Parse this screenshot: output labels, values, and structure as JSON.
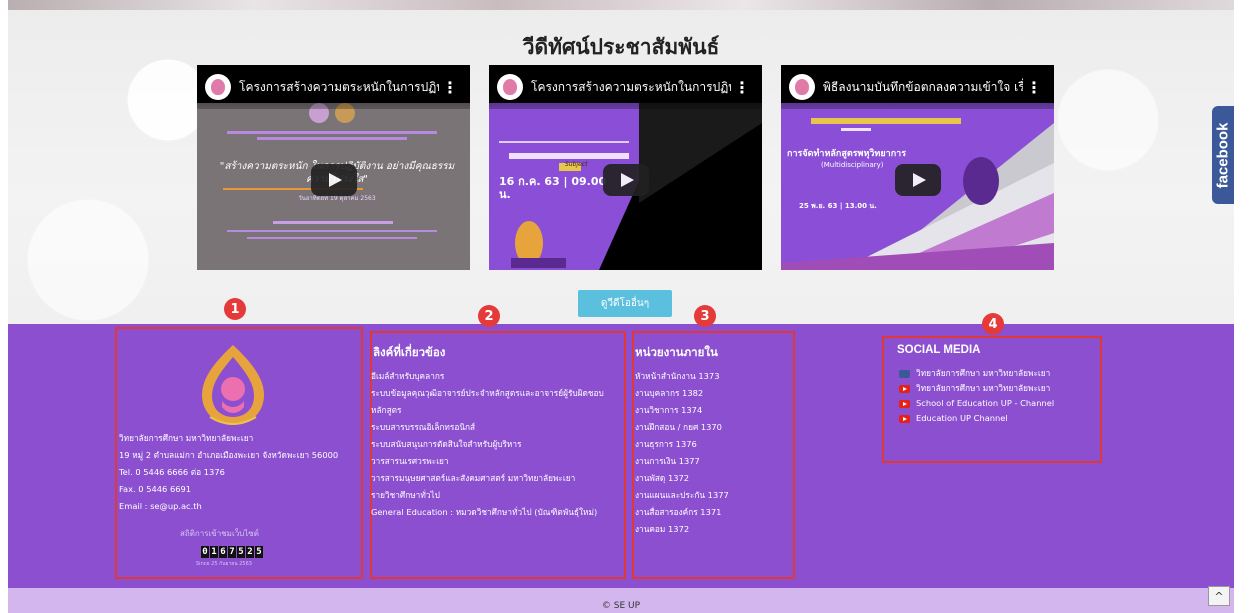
{
  "videos": {
    "section_title": "วีดีทัศน์ประชาสัมพันธ์",
    "items": [
      {
        "title": "โครงการสร้างความตระหนักในการปฏิบั...",
        "overlay_main": "\"สร้างความตระหนัก ในการปฏิบัติงาน อย่างมีคุณธรรมความโปร่งใส\"",
        "overlay_sub": "วันอาทิตย์ที่ 19 ตุลาคม 2563"
      },
      {
        "title": "โครงการสร้างความตระหนักในการปฏิบั...",
        "overlay_main": "16 ก.ค. 63 | 09.00 น.",
        "overlay_sub": "Subject"
      },
      {
        "title": "พิธีลงนามบันทึกข้อตกลงความเข้าใจ เรื่...",
        "overlay_main": "การจัดทำหลักสูตรพหุวิทยาการ",
        "overlay_sub": "(Multidisciplinary)",
        "overlay_date": "25 พ.ย. 63 | 13.00 น."
      }
    ],
    "more_button": "ดูวีดีโออื่นๆ"
  },
  "facebook_tab": "facebook",
  "footer": {
    "col1": {
      "badge": "1",
      "org_name": "วิทยาลัยการศึกษา มหาวิทยาลัยพะเยา",
      "address": "19 หมู่ 2 ตำบลแม่กา อำเภอเมืองพะเยา จังหวัดพะเยา 56000",
      "tel": "Tel. 0 5446 6666 ต่อ 1376",
      "fax": "Fax. 0 5446 6691",
      "email": "Email : se@up.ac.th",
      "stats_label": "สถิติการเข้าชมเว็บไซต์",
      "counter": [
        "0",
        "1",
        "6",
        "7",
        "5",
        "2",
        "5"
      ],
      "since": "Since 25 กันยายน 2563"
    },
    "col2": {
      "badge": "2",
      "heading": "ลิงค์ที่เกี่ยวข้อง",
      "links": [
        "อีเมล์สำหรับบุคลากร",
        "ระบบข้อมูลคุณวุฒิอาจารย์ประจำหลักสูตรและอาจารย์ผู้รับผิดชอบ",
        "หลักสูตร",
        "ระบบสารบรรณอิเล็กทรอนิกส์",
        "ระบบสนับสนุนการตัดสินใจสำหรับผู้บริหาร",
        "วารสารนเรศวรพะเยา",
        "วารสารมนุษยศาสตร์และสังคมศาสตร์ มหาวิทยาลัยพะเยา",
        "รายวิชาศึกษาทั่วไป",
        "General Education : หมวดวิชาศึกษาทั่วไป (บัณฑิตพันธุ์ใหม่)"
      ]
    },
    "col3": {
      "badge": "3",
      "heading": "หน่วยงานภายใน",
      "links": [
        "หัวหน้าสำนักงาน 1373",
        "งานบุคลากร 1382",
        "งานวิชาการ 1374",
        "งานฝึกสอน / กยศ 1370",
        "งานธุรการ 1376",
        "งานการเงิน 1377",
        "งานพัสดุ 1372",
        "งานแผนและประกัน 1377",
        "งานสื่อสารองค์กร 1371",
        "งานคอม 1372"
      ]
    },
    "col4": {
      "badge": "4",
      "heading": "SOCIAL MEDIA",
      "links": [
        {
          "label": "วิทยาลัยการศึกษา มหาวิทยาลัยพะเยา",
          "icon": "facebook-icon"
        },
        {
          "label": "วิทยาลัยการศึกษา มหาวิทยาลัยพะเยา",
          "icon": "youtube-icon"
        },
        {
          "label": "School of Education UP - Channel",
          "icon": "youtube-icon"
        },
        {
          "label": "Education UP Channel",
          "icon": "youtube-icon"
        }
      ]
    },
    "copyright": "© SE UP",
    "to_top": "^"
  },
  "colors": {
    "footer_bg": "#8b4fd0",
    "copy_bg": "#d4b6ee",
    "annotation_red": "#e53a3a",
    "more_btn": "#5bc0de",
    "facebook_blue": "#3b5998"
  }
}
